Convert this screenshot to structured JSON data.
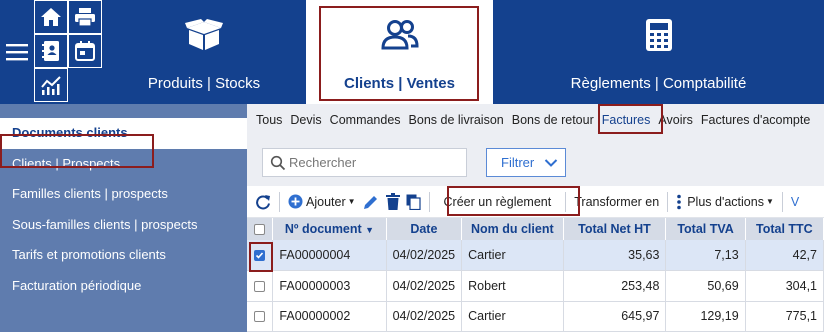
{
  "app": {
    "modules": [
      {
        "label": "Produits | Stocks",
        "icon": "box-icon"
      },
      {
        "label": "Clients | Ventes",
        "icon": "users-icon",
        "active": true
      },
      {
        "label": "Règlements | Comptabilité",
        "icon": "calculator-icon"
      }
    ],
    "quick_icons": [
      "home-icon",
      "print-icon",
      "contacts-book-icon",
      "calendar-icon",
      "chart-icon"
    ]
  },
  "sidebar": {
    "items": [
      {
        "label": "Documents clients",
        "active": true
      },
      {
        "label": "Clients | Prospects"
      },
      {
        "label": "Familles clients | prospects"
      },
      {
        "label": "Sous-familles clients | prospects"
      },
      {
        "label": "Tarifs et promotions clients"
      },
      {
        "label": "Facturation périodique"
      }
    ]
  },
  "tabs": [
    "Tous",
    "Devis",
    "Commandes",
    "Bons de livraison",
    "Bons de retour",
    "Factures",
    "Avoirs",
    "Factures d'acompte"
  ],
  "active_tab": "Factures",
  "search": {
    "placeholder": "Rechercher"
  },
  "filter": {
    "label": "Filtrer"
  },
  "toolbar": {
    "add_label": "Ajouter",
    "create_payment_label": "Créer un règlement",
    "transform_label": "Transformer en",
    "more_actions_label": "Plus d'actions"
  },
  "table": {
    "columns": [
      "Nº document",
      "Date",
      "Nom du client",
      "Total Net HT",
      "Total TVA",
      "Total TTC"
    ],
    "rows": [
      {
        "doc": "FA00000004",
        "date": "04/02/2025",
        "client": "Cartier",
        "ht": "35,63",
        "tva": "7,13",
        "ttc": "42,7",
        "selected": true
      },
      {
        "doc": "FA00000003",
        "date": "04/02/2025",
        "client": "Robert",
        "ht": "253,48",
        "tva": "50,69",
        "ttc": "304,1"
      },
      {
        "doc": "FA00000002",
        "date": "04/02/2025",
        "client": "Cartier",
        "ht": "645,97",
        "tva": "129,19",
        "ttc": "775,1"
      }
    ]
  },
  "colors": {
    "brand": "#14418e",
    "sidebar": "#5f7cae",
    "highlight": "#8b1d1d",
    "accent": "#2f6fd0"
  }
}
